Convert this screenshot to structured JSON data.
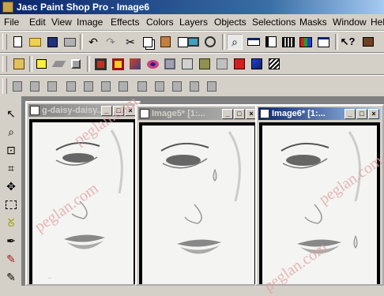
{
  "app": {
    "title": "Jasc Paint Shop Pro - Image6"
  },
  "menu": [
    "File",
    "Edit",
    "View",
    "Image",
    "Effects",
    "Colors",
    "Layers",
    "Objects",
    "Selections",
    "Masks",
    "Window",
    "Help"
  ],
  "documents": [
    {
      "title": "g-daisy-daisy..."
    },
    {
      "title": "Image5* [1:..."
    },
    {
      "title": "Image6* [1:..."
    }
  ],
  "watermark": "peglan.com",
  "colors": {
    "title_active": "#0a246a",
    "title_inactive": "#808080",
    "workspace": "#808080",
    "face": "#d4d0c8"
  }
}
